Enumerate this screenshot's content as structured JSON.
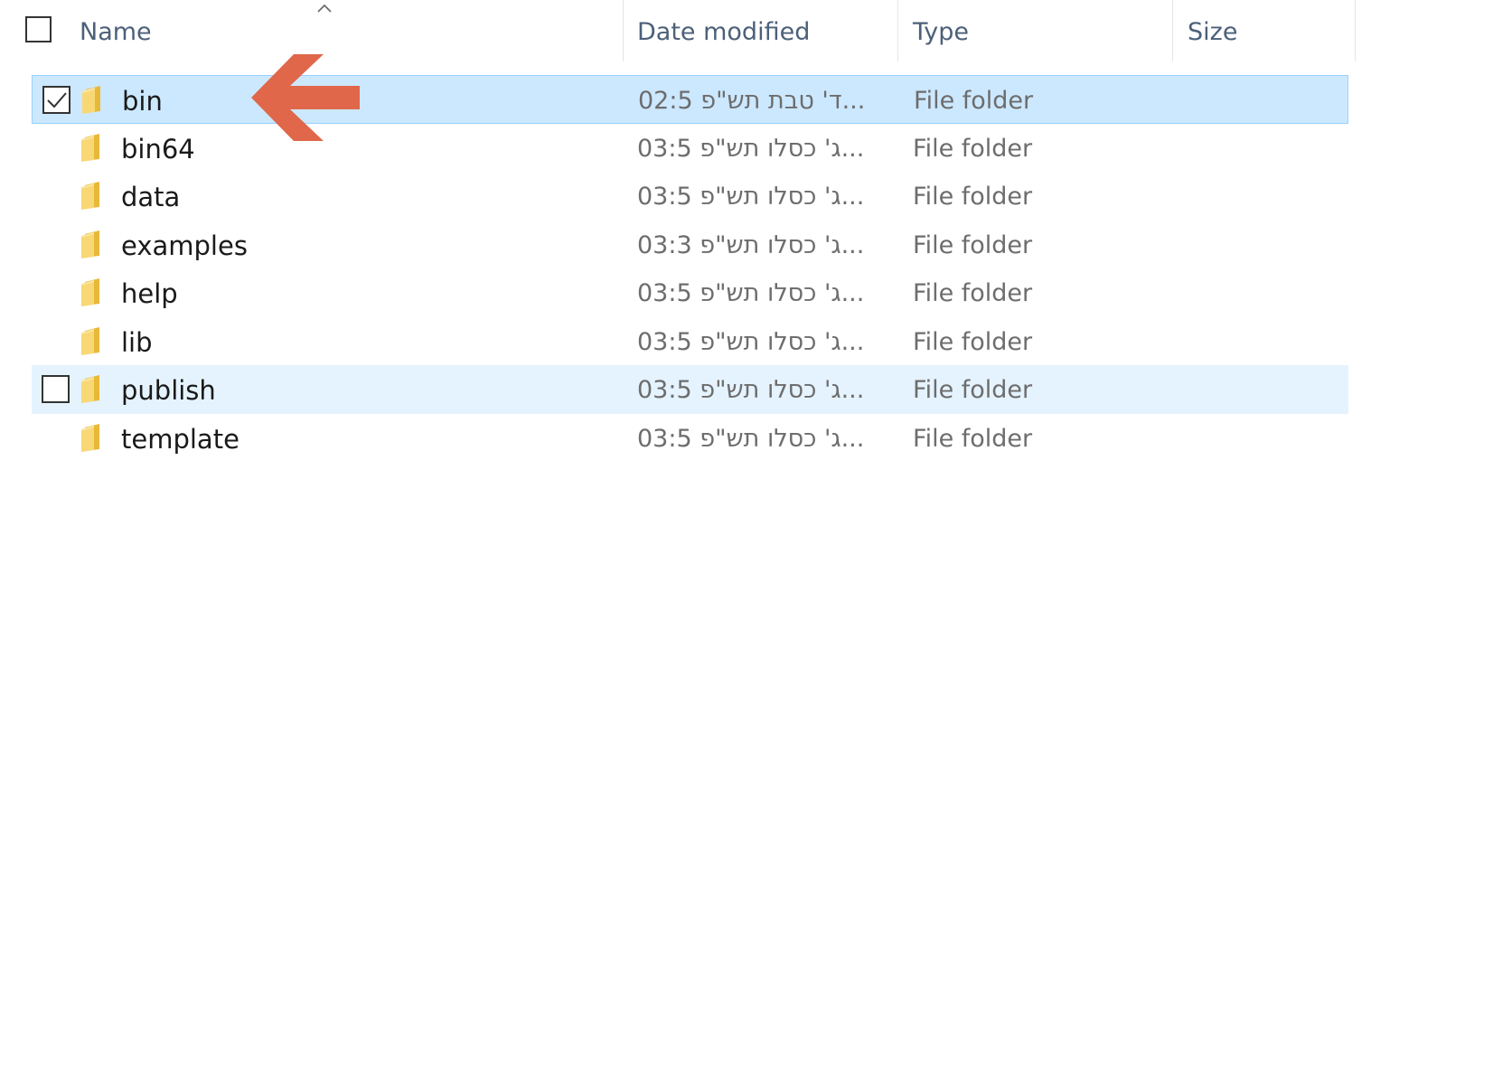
{
  "header": {
    "name_label": "Name",
    "date_label": "Date modified",
    "type_label": "Type",
    "size_label": "Size",
    "sort_icon": "chevron-up-icon"
  },
  "rows": [
    {
      "name": "bin",
      "date": "ד' טבת תש\"פ 02:5...",
      "type": "File folder",
      "size": "",
      "state": "selected",
      "checked": true
    },
    {
      "name": "bin64",
      "date": "ג' כסלו תש\"פ 03:5...",
      "type": "File folder",
      "size": "",
      "state": "normal",
      "checked": false
    },
    {
      "name": "data",
      "date": "ג' כסלו תש\"פ 03:5...",
      "type": "File folder",
      "size": "",
      "state": "normal",
      "checked": false
    },
    {
      "name": "examples",
      "date": "ג' כסלו תש\"פ 03:3...",
      "type": "File folder",
      "size": "",
      "state": "normal",
      "checked": false
    },
    {
      "name": "help",
      "date": "ג' כסלו תש\"פ 03:5...",
      "type": "File folder",
      "size": "",
      "state": "normal",
      "checked": false
    },
    {
      "name": "lib",
      "date": "ג' כסלו תש\"פ 03:5...",
      "type": "File folder",
      "size": "",
      "state": "normal",
      "checked": false
    },
    {
      "name": "publish",
      "date": "ג' כסלו תש\"פ 03:5...",
      "type": "File folder",
      "size": "",
      "state": "hover",
      "checked": false
    },
    {
      "name": "template",
      "date": "ג' כסלו תש\"פ 03:5...",
      "type": "File folder",
      "size": "",
      "state": "normal",
      "checked": false
    }
  ],
  "icons": {
    "folder": "folder-icon",
    "checkmark": "checkmark-icon",
    "annotation": "arrow-left-icon"
  },
  "colors": {
    "selected_bg": "#cce8ff",
    "selected_border": "#99d1ff",
    "hover_bg": "#e5f3ff",
    "header_text": "#4c607a",
    "annotation_arrow": "#e0674a",
    "folder_yellow": "#f8d775"
  }
}
